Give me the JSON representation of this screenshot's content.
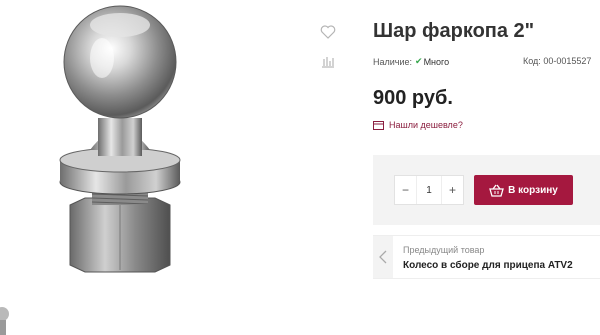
{
  "product": {
    "title": "Шар фаркопа 2\"",
    "stock_label": "Наличие:",
    "stock_value": "Много",
    "code_label": "Код:",
    "code_value": "00-0015527",
    "price": "900 руб.",
    "cheaper_link": "Нашли дешевле?",
    "image_icon": "chrome-tow-ball-photo"
  },
  "actions": {
    "favorite_icon": "heart-icon",
    "compare_icon": "bar-chart-icon"
  },
  "purchase": {
    "minus": "−",
    "quantity": "1",
    "plus": "+",
    "cart_label": "В корзину",
    "cart_icon": "basket-icon"
  },
  "prev_product": {
    "caption": "Предыдущий товар",
    "name": "Колесо в сборе для прицепа ATV2"
  },
  "colors": {
    "accent": "#a5183f",
    "in_stock": "#35a64b",
    "panel": "#f3f3f3"
  }
}
